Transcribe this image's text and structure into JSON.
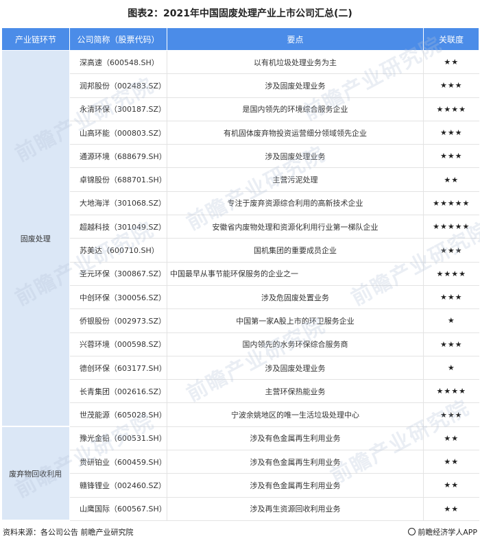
{
  "title": "图表2：2021年中国固废处理产业上市公司汇总(二)",
  "headers": {
    "segment": "产业链环节",
    "company": "公司简称（股票代码）",
    "point": "要点",
    "relevance": "关联度"
  },
  "segments": [
    {
      "label": "固废处理"
    },
    {
      "label": "废弃物回收利用"
    }
  ],
  "rows": [
    {
      "company": "深高速（600548.SH）",
      "point": "以有机垃圾处理业务为主",
      "relevance": "★★"
    },
    {
      "company": "润邦股份（002483.SZ）",
      "point": "涉及固废处理业务",
      "relevance": "★★★"
    },
    {
      "company": "永清环保（300187.SZ）",
      "point": "是国内领先的环境综合服务企业",
      "relevance": "★★★★"
    },
    {
      "company": "山高环能（000803.SZ）",
      "point": "有机固体废弃物投资运营细分领域领先企业",
      "relevance": "★★★"
    },
    {
      "company": "通源环境（688679.SH）",
      "point": "涉及固废处理业务",
      "relevance": "★★★"
    },
    {
      "company": "卓锦股份（688701.SH）",
      "point": "主营污泥处理",
      "relevance": "★★"
    },
    {
      "company": "大地海洋（301068.SZ）",
      "point": "专注于废弃资源综合利用的高新技术企业",
      "relevance": "★★★★★"
    },
    {
      "company": "超越科技（301049.SZ）",
      "point": "安徽省内废物处理和资源化利用行业第一梯队企业",
      "relevance": "★★★★★"
    },
    {
      "company": "苏美达（600710.SH）",
      "point": "国机集团的重要成员企业",
      "relevance": "★★★"
    },
    {
      "company": "圣元环保（300867.SZ）",
      "point": "中国最早从事节能环保服务的企业之一",
      "relevance": "★★★★"
    },
    {
      "company": "中创环保（300056.SZ）",
      "point": "涉及危固废处置业务",
      "relevance": "★★★"
    },
    {
      "company": "侨银股份（002973.SZ）",
      "point": "中国第一家A股上市的环卫服务企业",
      "relevance": "★"
    },
    {
      "company": "兴蓉环境（000598.SZ）",
      "point": "国内领先的水务环保综合服务商",
      "relevance": "★★★"
    },
    {
      "company": "德创环保（603177.SH）",
      "point": "涉及固废处理业务",
      "relevance": "★"
    },
    {
      "company": "长青集团（002616.SZ）",
      "point": "主营环保热能业务",
      "relevance": "★★★★"
    },
    {
      "company": "世茂能源（605028.SH）",
      "point": "宁波余姚地区的唯一生活垃圾处理中心",
      "relevance": "★★★"
    },
    {
      "company": "豫光金铅（600531.SH）",
      "point": "涉及有色金属再生利用业务",
      "relevance": "★★"
    },
    {
      "company": "贵研铂业（600459.SH）",
      "point": "涉及有色金属再生利用业务",
      "relevance": "★★"
    },
    {
      "company": "赣锋锂业（002460.SZ）",
      "point": "涉及有色金属再生利用业务",
      "relevance": "★★"
    },
    {
      "company": "山鹰国际（600567.SH）",
      "point": "涉及再生资源回收利用业务",
      "relevance": "★★"
    }
  ],
  "footer": {
    "source": "资料来源：各公司公告 前瞻产业研究院",
    "brand": "前瞻经济学人APP"
  },
  "watermark": "前瞻产业研究院"
}
